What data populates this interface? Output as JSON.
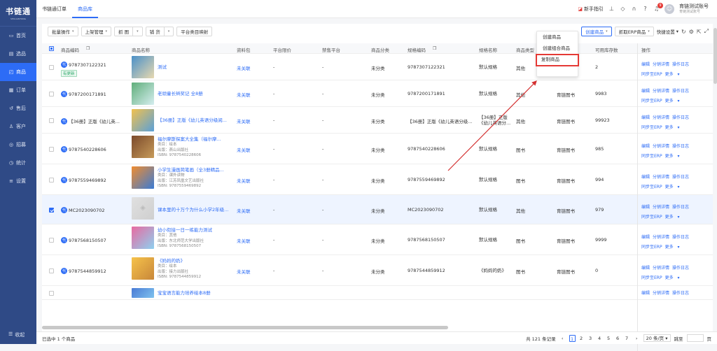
{
  "sidebar": {
    "logo": "书链通",
    "logo_sub": "SHULIANTONG",
    "items": [
      {
        "label": "首页",
        "icon": "home-icon"
      },
      {
        "label": "选品",
        "icon": "select-icon"
      },
      {
        "label": "商品",
        "icon": "goods-icon",
        "active": true
      },
      {
        "label": "订单",
        "icon": "order-icon"
      },
      {
        "label": "售后",
        "icon": "aftersale-icon"
      },
      {
        "label": "客户",
        "icon": "customer-icon"
      },
      {
        "label": "招募",
        "icon": "recruit-icon"
      },
      {
        "label": "统计",
        "icon": "stats-icon"
      },
      {
        "label": "设置",
        "icon": "settings-icon"
      }
    ],
    "collapse": "收起"
  },
  "topbar": {
    "tabs": [
      "书链通订单",
      "商品库"
    ],
    "guide": "新手指引",
    "badge": "9",
    "account_name": "育链测试账号",
    "account_sub": "育链测试账号"
  },
  "toolbar": {
    "batch": "批量操作",
    "shelf": "上架管理",
    "grab": "抓 图",
    "fill": "铺 货",
    "mapping": "平台类目映射",
    "create": "创建商品",
    "grab_erp": "抓取ERP商品",
    "quick": "快捷设置"
  },
  "menu": {
    "items": [
      "创建商品",
      "创建组合商品",
      "复制商品"
    ]
  },
  "table": {
    "headers": [
      "商品编码",
      "商品名称",
      "资料包",
      "平台限价",
      "禁售平台",
      "商品分类",
      "规格编码",
      "规格名称",
      "商品类型",
      "",
      "可用库存数",
      "",
      "操作"
    ],
    "rows": [
      {
        "code": "9787307122321",
        "tag": "有更新",
        "name": [
          "测试"
        ],
        "meta": [],
        "pkg": "未关联",
        "limit": "-",
        "ban": "-",
        "cat": "未分类",
        "spec_code": "9787307122321",
        "spec_name": "默认规格",
        "type": "其他",
        "kind": "",
        "stock": "2"
      },
      {
        "code": "9787200171891",
        "name": [
          "老顽童长辫奖记 全8册"
        ],
        "meta": [],
        "pkg": "未关联",
        "limit": "-",
        "ban": "-",
        "cat": "未分类",
        "spec_code": "9787200171891",
        "spec_name": "默认规格",
        "type": "其他",
        "kind": "育链图书",
        "stock": "9983"
      },
      {
        "code": "【36册】正版《幼儿英...",
        "name": [
          "【36册】正版《幼儿英语分级阅..."
        ],
        "meta": [],
        "pkg": "未关联",
        "limit": "-",
        "ban": "-",
        "cat": "未分类",
        "spec_code": "【36册】正版《幼儿英语分级...",
        "spec_name": "【36册】正版《幼儿英语分...",
        "type": "其他",
        "kind": "育链图书",
        "stock": "99923"
      },
      {
        "code": "9787540228606",
        "name": [
          "福尔摩斯探案大全集（福尔摩..."
        ],
        "meta": [
          "类目：绘本",
          "出版：燕山出版社",
          "ISBN: 9787540228606"
        ],
        "pkg": "未关联",
        "limit": "-",
        "ban": "-",
        "cat": "未分类",
        "spec_code": "9787540228606",
        "spec_name": "默认规格",
        "type": "图书",
        "kind": "育链图书",
        "stock": "985"
      },
      {
        "code": "9787559469892",
        "name": [
          "小学生漫画简笔画（全3册精品..."
        ],
        "meta": [
          "类目：课外读物",
          "出版：江苏凤凰文艺出版社",
          "ISBN: 9787559469892"
        ],
        "pkg": "未关联",
        "limit": "-",
        "ban": "-",
        "cat": "未分类",
        "spec_code": "9787559469892",
        "spec_name": "默认规格",
        "type": "图书",
        "kind": "育链图书",
        "stock": "994"
      },
      {
        "code": "MC2023090702",
        "name": [
          "课本里的十万个为什么小学2年级..."
        ],
        "meta": [],
        "pkg": "未关联",
        "limit": "-",
        "ban": "-",
        "cat": "未分类",
        "spec_code": "MC2023090702",
        "spec_name": "默认规格",
        "type": "其他",
        "kind": "育链图书",
        "stock": "979",
        "selected": true
      },
      {
        "code": "9787568150507",
        "name": [
          "幼小衔接一日一练能力测试"
        ],
        "meta": [
          "类目：其他",
          "出版：东北师范大学出版社",
          "ISBN: 9787568150507"
        ],
        "pkg": "未关联",
        "limit": "-",
        "ban": "-",
        "cat": "未分类",
        "spec_code": "9787568150507",
        "spec_name": "默认规格",
        "type": "图书",
        "kind": "育链图书",
        "stock": "9999"
      },
      {
        "code": "9787544859912",
        "name": [
          "《妈妈的奶》"
        ],
        "meta": [
          "类目：绘本",
          "出版：接力出版社",
          "ISBN: 9787544859912"
        ],
        "pkg": "未关联",
        "limit": "-",
        "ban": "-",
        "cat": "未分类",
        "spec_code": "9787544859912",
        "spec_name": "《妈妈的奶》",
        "type": "图书",
        "kind": "育链图书",
        "stock": "0"
      },
      {
        "code": "",
        "name": [
          "宝宝语言能力培养绘本8册"
        ],
        "meta": [],
        "pkg": "",
        "limit": "",
        "ban": "",
        "cat": "",
        "spec_code": "",
        "spec_name": "",
        "type": "",
        "kind": "",
        "stock": ""
      }
    ],
    "ops": {
      "edit": "编辑",
      "detail": "分销详情",
      "log": "操作日志",
      "sync": "同步至ERP",
      "more": "更多"
    }
  },
  "footer": {
    "selected": "已选中 1 个商品",
    "total": "共 121 条记录",
    "pages": [
      "1",
      "2",
      "3",
      "4",
      "5",
      "6",
      "7"
    ],
    "per": "20 条/页",
    "goto": "跳至",
    "page_unit": "页"
  }
}
